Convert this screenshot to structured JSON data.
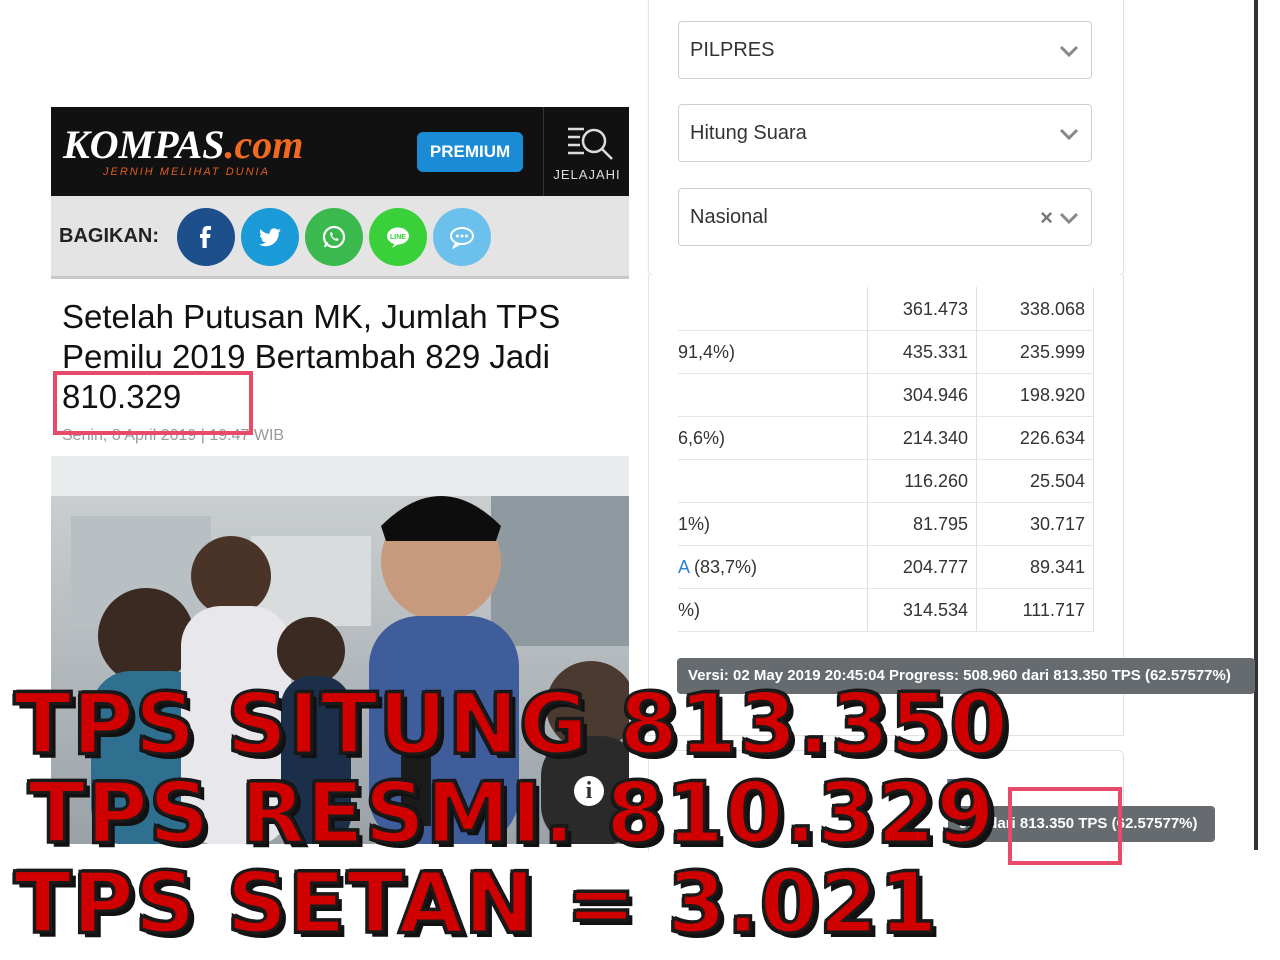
{
  "kompas": {
    "logo_main": "KOMPAS",
    "logo_dot": ".com",
    "tagline": "JERNIH MELIHAT DUNIA",
    "premium_label": "PREMIUM",
    "jelajahi_label": "JELAJAHI",
    "share_label": "BAGIKAN:",
    "share_buttons": [
      {
        "name": "facebook",
        "color": "#1d4f8c"
      },
      {
        "name": "twitter",
        "color": "#1a9ad6"
      },
      {
        "name": "whatsapp",
        "color": "#3cb94e"
      },
      {
        "name": "line",
        "color": "#3ad03a"
      },
      {
        "name": "comment",
        "color": "#6cc0ec"
      }
    ],
    "headline": "Setelah Putusan MK, Jumlah TPS Pemilu 2019 Bertambah 829 Jadi 810.329",
    "dateline": "Senin, 8 April 2019 | 19:47 WIB"
  },
  "filters": {
    "election": "PILPRES",
    "mode": "Hitung Suara",
    "region": "Nasional"
  },
  "table": {
    "rows": [
      {
        "name": "",
        "name_blue": "",
        "v1": "361.473",
        "v2": "338.068"
      },
      {
        "name": "91,4%)",
        "name_blue": "",
        "v1": "435.331",
        "v2": "235.999"
      },
      {
        "name": "",
        "name_blue": "",
        "v1": "304.946",
        "v2": "198.920"
      },
      {
        "name": "6,6%)",
        "name_blue": "",
        "v1": "214.340",
        "v2": "226.634"
      },
      {
        "name": "",
        "name_blue": "",
        "v1": "116.260",
        "v2": "25.504"
      },
      {
        "name": "1%)",
        "name_blue": "",
        "v1": "81.795",
        "v2": "30.717"
      },
      {
        "name": " (83,7%)",
        "name_blue": "A",
        "v1": "204.777",
        "v2": "89.341"
      },
      {
        "name": "%)",
        "name_blue": "",
        "v1": "314.534",
        "v2": "111.717"
      }
    ]
  },
  "tooltip_top": "Versi: 02 May 2019 20:45:04 Progress: 508.960 dari 813.350 TPS (62.57577%)",
  "tooltip_bottom": "960 dari 813.350 TPS (62.57577%)",
  "lower_card_letter": "R",
  "overlay": {
    "line1": "TPS SITUNG 813.350",
    "line2": "TPS RESMI.  810.329",
    "line3": "TPS SETAN =     3.021"
  }
}
